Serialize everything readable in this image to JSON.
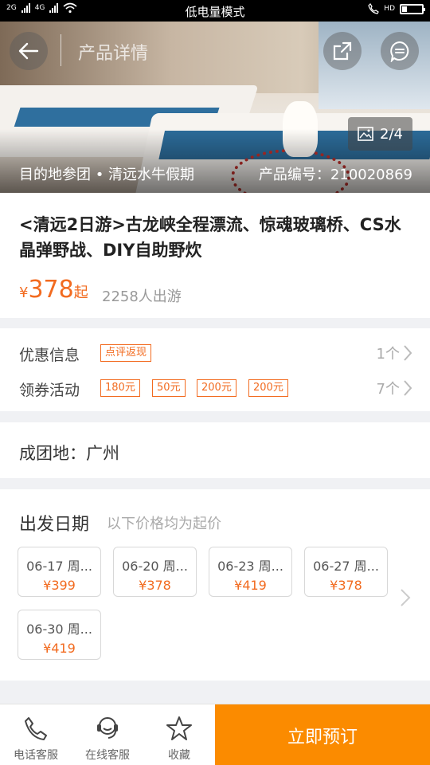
{
  "status_bar": {
    "signal_1": "2G",
    "signal_2": "4G",
    "mode_text": "低电量模式",
    "hd": "HD"
  },
  "header": {
    "title": "产品详情",
    "image_counter": "2/4"
  },
  "hero": {
    "caption": "目的地参团 • 清远水牛假期",
    "product_code": "产品编号：210020869"
  },
  "product": {
    "title": "<清远2日游>古龙峡全程漂流、惊魂玻璃桥、CS水晶弹野战、DIY自助野炊",
    "price_symbol": "¥",
    "price_value": "378",
    "price_suffix": "起",
    "travelers": "2258人出游"
  },
  "promotions": {
    "discount_label": "优惠信息",
    "discount_tag": "点评返现",
    "discount_count": "1个",
    "coupon_label": "领券活动",
    "coupon_tags": [
      "180元",
      "50元",
      "200元",
      "200元"
    ],
    "coupon_count": "7个"
  },
  "origin": {
    "text": "成团地：广州"
  },
  "departure": {
    "title": "出发日期",
    "subtitle": "以下价格均为起价",
    "dates": [
      {
        "date": "06-17 周...",
        "price": "¥399"
      },
      {
        "date": "06-20 周...",
        "price": "¥378"
      },
      {
        "date": "06-23 周...",
        "price": "¥419"
      },
      {
        "date": "06-27 周...",
        "price": "¥378"
      },
      {
        "date": "06-30 周...",
        "price": "¥419"
      }
    ]
  },
  "bottom_bar": {
    "phone": "电话客服",
    "online": "在线客服",
    "favorite": "收藏",
    "book": "立即预订"
  },
  "colors": {
    "accent": "#f26b20",
    "book_button": "#fb8b00"
  }
}
